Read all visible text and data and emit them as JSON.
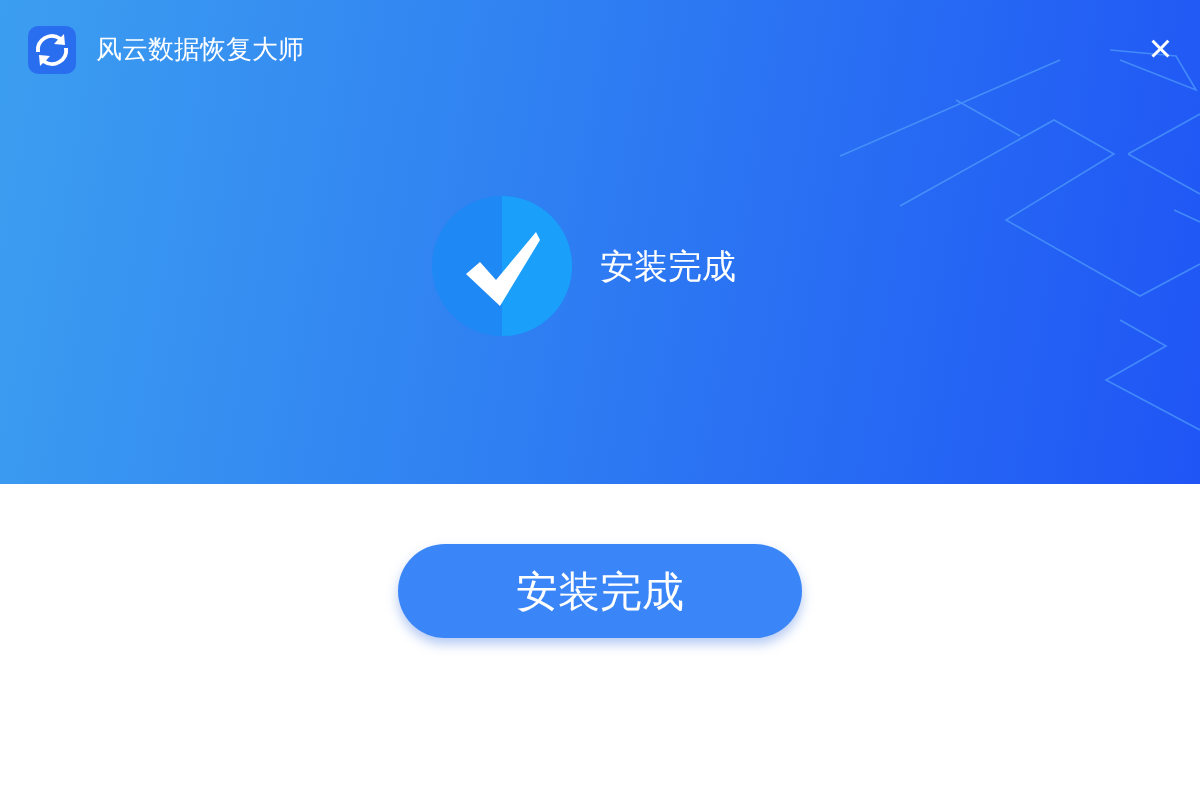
{
  "window": {
    "title": "风云数据恢复大师",
    "close": "×"
  },
  "status": {
    "message": "安装完成"
  },
  "buttons": [
    {
      "label": "安装完成"
    }
  ]
}
